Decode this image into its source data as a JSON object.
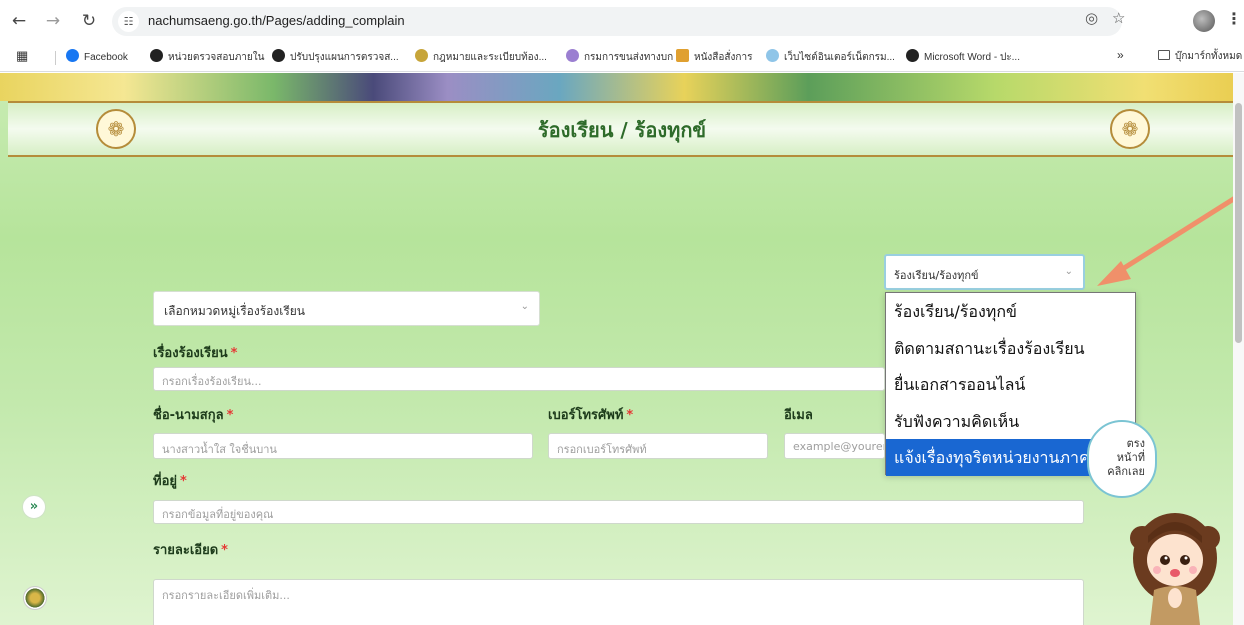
{
  "browser": {
    "url": "nachumsaeng.go.th/Pages/adding_complain",
    "bookmarks": [
      "Facebook",
      "หน่วยตรวจสอบภายใน",
      "ปรับปรุงแผนการตรวจส...",
      "กฎหมายและระเบียบท้อง...",
      "กรมการขนส่งทางบก",
      "หนังสือสั่งการ",
      "เว็บไซต์อินเตอร์เน็ตกรม...",
      "Microsoft Word - ปะ..."
    ],
    "bookmarks_overflow": "»",
    "all_bookmarks": "บุ๊กมาร์กทั้งหมด"
  },
  "page": {
    "title": "ร้องเรียน / ร้องทุกข์",
    "menu_select_value": "ร้องเรียน/ร้องทุกข์",
    "menu_options": [
      "ร้องเรียน/ร้องทุกข์",
      "ติดตามสถานะเรื่องร้องเรียน",
      "ยื่นเอกสารออนไลน์",
      "รับฟังความคิดเห็น",
      "แจ้งเรื่องทุจริตหน่วยงานภาครัฐ"
    ],
    "menu_selected_index": 4,
    "category_select": "เลือกหมวดหมู่เรื่องร้องเรียน",
    "form": {
      "subject_label": "เรื่องร้องเรียน",
      "subject_placeholder": "กรอกเรื่องร้องเรียน...",
      "name_label": "ชื่อ-นามสกุล",
      "name_placeholder": "นางสาวน้ำใส ใจชื่นบาน",
      "phone_label": "เบอร์โทรศัพท์",
      "phone_placeholder": "กรอกเบอร์โทรศัพท์",
      "email_label": "อีเมล",
      "email_placeholder": "example@youremail.com",
      "address_label": "ที่อยู่",
      "address_placeholder": "กรอกข้อมูลที่อยู่ของคุณ",
      "detail_label": "รายละเอียด",
      "detail_placeholder": "กรอกรายละเอียดเพิ่มเติม...",
      "required_mark": "*"
    },
    "bubble_lines": [
      "ตรง",
      "หน้าที่",
      "คลิกเลย"
    ]
  },
  "colors": {
    "accent_green": "#2e6b2a",
    "dropdown_selected": "#1967d2",
    "annotation_arrow": "#f0906a"
  }
}
